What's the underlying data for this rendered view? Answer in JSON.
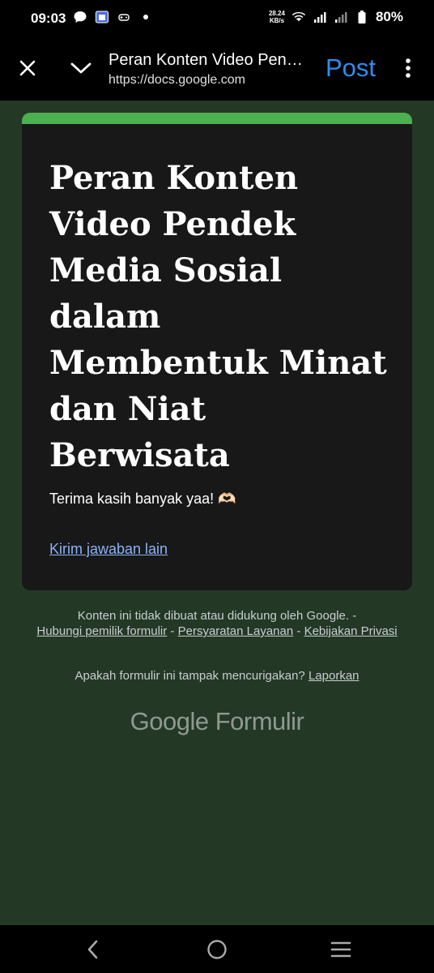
{
  "status_bar": {
    "time": "09:03",
    "net_speed_value": "28.24",
    "net_speed_unit": "KB/s",
    "battery": "80%"
  },
  "toolbar": {
    "title": "Peran Konten Video Pendek Media Sosial dalam Membentuk Minat dan Niat Berwisata",
    "url": "https://docs.google.com",
    "post_label": "Post"
  },
  "form": {
    "accent_color": "#4caf50",
    "title": "Peran Konten Video Pendek Media Sosial dalam Membentuk Minat dan Niat Berwisata",
    "message": "Terima kasih banyak yaa! 🫶🏻",
    "submit_another_link": "Kirim jawaban lain"
  },
  "footer": {
    "disclaimer": "Konten ini tidak dibuat atau didukung oleh Google.",
    "separator": " - ",
    "contact_owner": "Hubungi pemilik formulir",
    "terms": "Persyaratan Layanan",
    "privacy": "Kebijakan Privasi",
    "suspicious_question": "Apakah formulir ini tampak mencurigakan?",
    "report": "Laporkan",
    "logo_google": "Google",
    "logo_product": "Formulir"
  },
  "icons": {
    "close": "close-icon",
    "expand": "chevron-down-icon",
    "more": "more-vert-icon",
    "nav_back": "back-icon",
    "nav_home": "home-icon",
    "nav_recents": "recents-icon"
  }
}
